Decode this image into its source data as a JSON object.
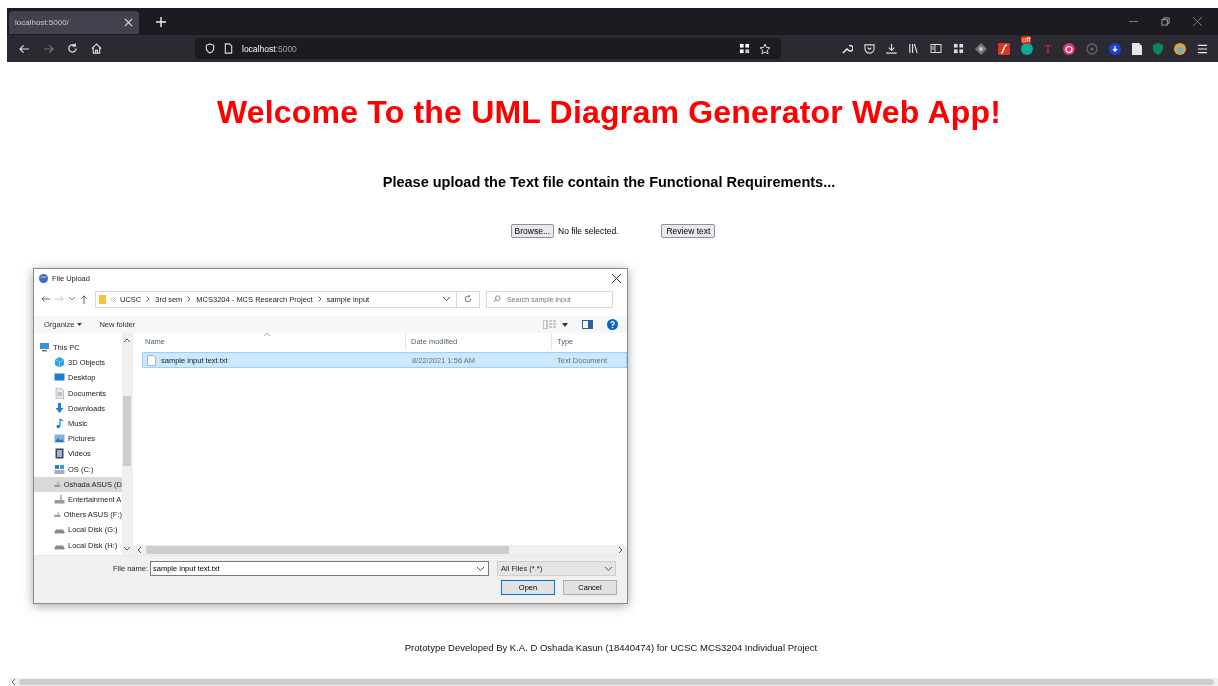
{
  "browser": {
    "tab": {
      "title": "localhost:5000/",
      "selected": true
    },
    "url": {
      "host": "localhost",
      "port": ":5000"
    },
    "extension_badge": "off",
    "extension_letter": "T"
  },
  "page": {
    "title": "Welcome To the UML Diagram Generator Web App!",
    "instruction": "Please upload the Text file contain the Functional Requirements...",
    "file_input": {
      "button": "Browse...",
      "status": "No file selected."
    },
    "review_button": "Review text",
    "footer": "Prototype Developed By K.A. D Oshada Kasun (18440474) for UCSC MCS3204 Individual Project"
  },
  "dialog": {
    "title": "File Upload",
    "breadcrumb": [
      "UCSC",
      "3rd sem",
      "MCS3204 - MCS Research Project",
      "sample input"
    ],
    "search": {
      "placeholder": "Search sample input"
    },
    "commands": [
      "Organize",
      "New folder"
    ],
    "nav_items": [
      {
        "label": "This PC",
        "kind": "pc",
        "selected": false
      },
      {
        "label": "3D Objects",
        "kind": "objects",
        "selected": false
      },
      {
        "label": "Desktop",
        "kind": "desktop",
        "selected": false
      },
      {
        "label": "Documents",
        "kind": "documents",
        "selected": false
      },
      {
        "label": "Downloads",
        "kind": "downloads",
        "selected": false
      },
      {
        "label": "Music",
        "kind": "music",
        "selected": false
      },
      {
        "label": "Pictures",
        "kind": "pictures",
        "selected": false
      },
      {
        "label": "Videos",
        "kind": "videos",
        "selected": false
      },
      {
        "label": "OS (C:)",
        "kind": "system",
        "selected": false
      },
      {
        "label": "Oshada ASUS (D",
        "kind": "drive",
        "selected": true
      },
      {
        "label": "Entertainment A",
        "kind": "drive",
        "selected": false
      },
      {
        "label": "Others ASUS (F:)",
        "kind": "drive",
        "selected": false
      },
      {
        "label": "Local Disk (G:)",
        "kind": "disk",
        "selected": false
      },
      {
        "label": "Local Disk (H:)",
        "kind": "disk",
        "selected": false
      }
    ],
    "columns": [
      "Name",
      "Date modified",
      "Type"
    ],
    "files": [
      {
        "name": "sample input text.txt",
        "date": "8/22/2021 1:56 AM",
        "type": "Text Document",
        "selected": true
      }
    ],
    "file_name_label": "File name:",
    "file_name": "sample input text.txt",
    "file_type": "All Files (*.*)",
    "buttons": [
      {
        "label": "Open",
        "default": true
      },
      {
        "label": "Cancel",
        "default": false
      }
    ]
  }
}
